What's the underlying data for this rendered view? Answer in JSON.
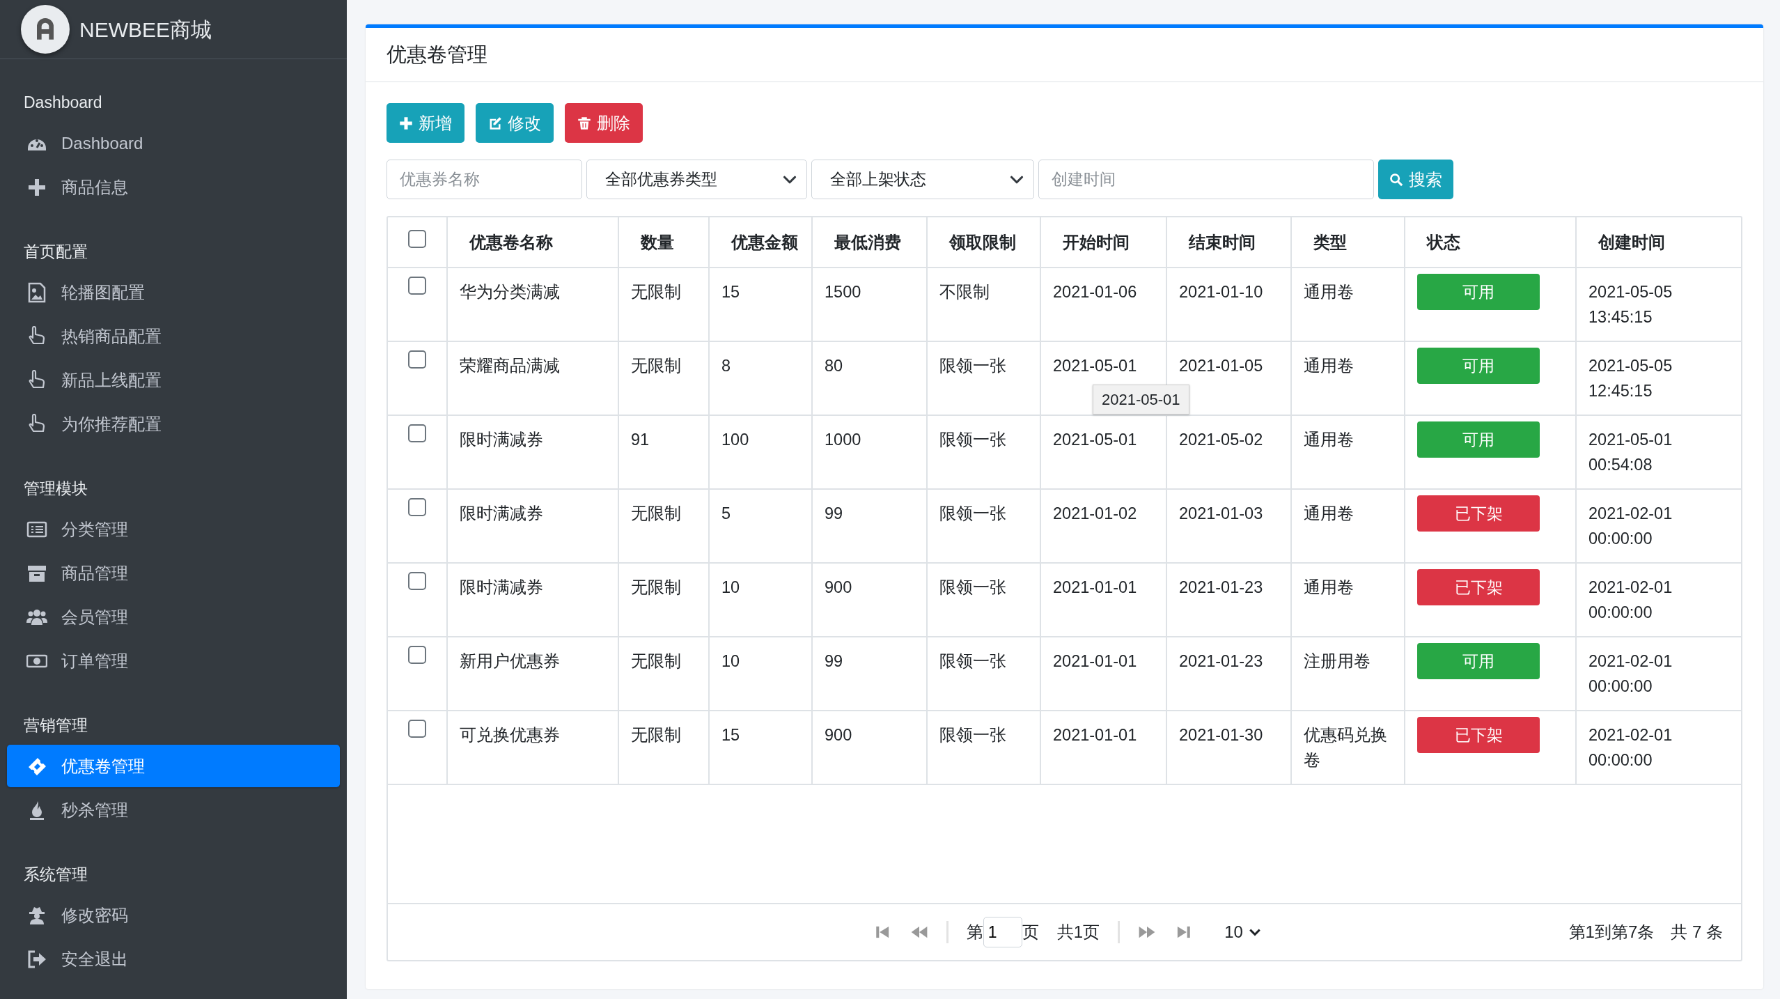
{
  "brand": {
    "name": "NEWBEE商城"
  },
  "sidebar": {
    "sections": [
      {
        "title": "Dashboard",
        "items": [
          {
            "label": "Dashboard",
            "kind": "gauge",
            "selected": false
          },
          {
            "label": "商品信息",
            "kind": "plus",
            "selected": false
          }
        ]
      },
      {
        "title": "首页配置",
        "items": [
          {
            "label": "轮播图配置",
            "kind": "image",
            "selected": false
          },
          {
            "label": "热销商品配置",
            "kind": "hand",
            "selected": false
          },
          {
            "label": "新品上线配置",
            "kind": "hand",
            "selected": false
          },
          {
            "label": "为你推荐配置",
            "kind": "hand",
            "selected": false
          }
        ]
      },
      {
        "title": "管理模块",
        "items": [
          {
            "label": "分类管理",
            "kind": "list",
            "selected": false
          },
          {
            "label": "商品管理",
            "kind": "archive",
            "selected": false
          },
          {
            "label": "会员管理",
            "kind": "users",
            "selected": false
          },
          {
            "label": "订单管理",
            "kind": "money",
            "selected": false
          }
        ]
      },
      {
        "title": "营销管理",
        "items": [
          {
            "label": "优惠卷管理",
            "kind": "ticket",
            "selected": true
          },
          {
            "label": "秒杀管理",
            "kind": "fire",
            "selected": false
          }
        ]
      },
      {
        "title": "系统管理",
        "items": [
          {
            "label": "修改密码",
            "kind": "spy",
            "selected": false
          },
          {
            "label": "安全退出",
            "kind": "exit",
            "selected": false
          }
        ]
      }
    ]
  },
  "page": {
    "title": "优惠卷管理"
  },
  "toolbar": {
    "buttons": [
      {
        "label": "新增",
        "kind": "add"
      },
      {
        "label": "修改",
        "kind": "edit"
      },
      {
        "label": "删除",
        "kind": "delete"
      }
    ]
  },
  "filters": {
    "name": {
      "placeholder": "优惠券名称"
    },
    "type": {
      "value": "全部优惠券类型"
    },
    "status": {
      "value": "全部上架状态"
    },
    "created": {
      "placeholder": "创建时间"
    },
    "search_button": "搜索"
  },
  "table": {
    "header_checked": false,
    "columns": [
      "优惠卷名称",
      "数量",
      "优惠金额",
      "最低消费",
      "领取限制",
      "开始时间",
      "结束时间",
      "类型",
      "状态",
      "创建时间"
    ],
    "rows": [
      {
        "checked": false,
        "cells": [
          "华为分类满减",
          "无限制",
          "15",
          "1500",
          "不限制",
          "2021-01-06",
          "2021-01-10",
          "通用卷"
        ],
        "status": {
          "text": "可用",
          "kind": "available"
        },
        "created": "2021-05-05 13:45:15"
      },
      {
        "checked": false,
        "cells": [
          "荣耀商品满减",
          "无限制",
          "8",
          "80",
          "限领一张",
          "2021-05-01",
          "2021-01-05",
          "通用卷"
        ],
        "status": {
          "text": "可用",
          "kind": "available"
        },
        "created": "2021-05-05 12:45:15"
      },
      {
        "checked": false,
        "cells": [
          "限时满减券",
          "91",
          "100",
          "1000",
          "限领一张",
          "2021-05-01",
          "2021-05-02",
          "通用卷"
        ],
        "status": {
          "text": "可用",
          "kind": "available"
        },
        "created": "2021-05-01 00:54:08"
      },
      {
        "checked": false,
        "cells": [
          "限时满减券",
          "无限制",
          "5",
          "99",
          "限领一张",
          "2021-01-02",
          "2021-01-03",
          "通用卷"
        ],
        "status": {
          "text": "已下架",
          "kind": "off"
        },
        "created": "2021-02-01 00:00:00"
      },
      {
        "checked": false,
        "cells": [
          "限时满减券",
          "无限制",
          "10",
          "900",
          "限领一张",
          "2021-01-01",
          "2021-01-23",
          "通用卷"
        ],
        "status": {
          "text": "已下架",
          "kind": "off"
        },
        "created": "2021-02-01 00:00:00"
      },
      {
        "checked": false,
        "cells": [
          "新用户优惠券",
          "无限制",
          "10",
          "99",
          "限领一张",
          "2021-01-01",
          "2021-01-23",
          "注册用卷"
        ],
        "status": {
          "text": "可用",
          "kind": "available"
        },
        "created": "2021-02-01 00:00:00"
      },
      {
        "checked": false,
        "cells": [
          "可兑换优惠券",
          "无限制",
          "15",
          "900",
          "限领一张",
          "2021-01-01",
          "2021-01-30",
          "优惠码兑换卷"
        ],
        "status": {
          "text": "已下架",
          "kind": "off"
        },
        "created": "2021-02-01 00:00:00"
      }
    ]
  },
  "tooltip": "2021-05-01",
  "pagination": {
    "page_prefix": "第",
    "page": "1",
    "page_suffix": "页",
    "total_pages": "共1页",
    "page_size": "10",
    "summary": "第1到第7条",
    "total": "共 7 条"
  }
}
